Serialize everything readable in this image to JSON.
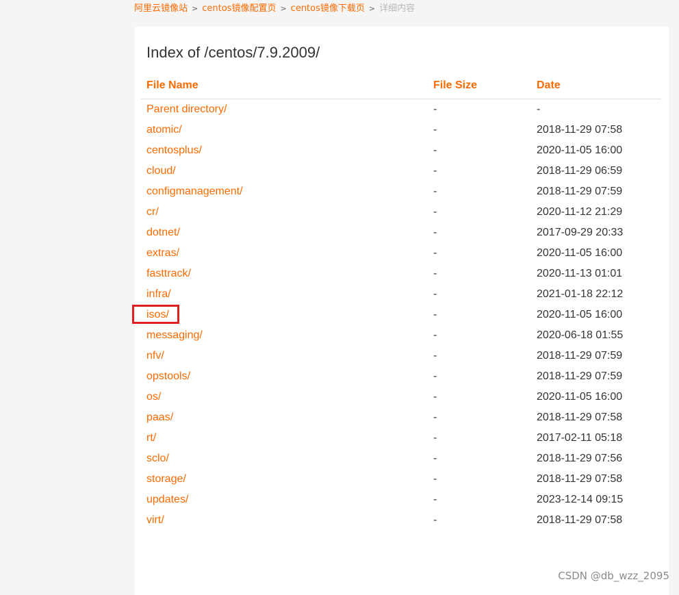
{
  "breadcrumb": {
    "items": [
      "阿里云镜像站",
      "centos镜像配置页",
      "centos镜像下载页"
    ],
    "current": "详细内容",
    "separator": ">"
  },
  "page": {
    "title": "Index of /centos/7.9.2009/"
  },
  "table": {
    "headers": {
      "name": "File Name",
      "size": "File Size",
      "date": "Date"
    },
    "rows": [
      {
        "name": "Parent directory/",
        "size": "-",
        "date": "-"
      },
      {
        "name": "atomic/",
        "size": "-",
        "date": "2018-11-29 07:58"
      },
      {
        "name": "centosplus/",
        "size": "-",
        "date": "2020-11-05 16:00"
      },
      {
        "name": "cloud/",
        "size": "-",
        "date": "2018-11-29 06:59"
      },
      {
        "name": "configmanagement/",
        "size": "-",
        "date": "2018-11-29 07:59"
      },
      {
        "name": "cr/",
        "size": "-",
        "date": "2020-11-12 21:29"
      },
      {
        "name": "dotnet/",
        "size": "-",
        "date": "2017-09-29 20:33"
      },
      {
        "name": "extras/",
        "size": "-",
        "date": "2020-11-05 16:00"
      },
      {
        "name": "fasttrack/",
        "size": "-",
        "date": "2020-11-13 01:01"
      },
      {
        "name": "infra/",
        "size": "-",
        "date": "2021-01-18 22:12"
      },
      {
        "name": "isos/",
        "size": "-",
        "date": "2020-11-05 16:00"
      },
      {
        "name": "messaging/",
        "size": "-",
        "date": "2020-06-18 01:55"
      },
      {
        "name": "nfv/",
        "size": "-",
        "date": "2018-11-29 07:59"
      },
      {
        "name": "opstools/",
        "size": "-",
        "date": "2018-11-29 07:59"
      },
      {
        "name": "os/",
        "size": "-",
        "date": "2020-11-05 16:00"
      },
      {
        "name": "paas/",
        "size": "-",
        "date": "2018-11-29 07:58"
      },
      {
        "name": "rt/",
        "size": "-",
        "date": "2017-02-11 05:18"
      },
      {
        "name": "sclo/",
        "size": "-",
        "date": "2018-11-29 07:56"
      },
      {
        "name": "storage/",
        "size": "-",
        "date": "2018-11-29 07:58"
      },
      {
        "name": "updates/",
        "size": "-",
        "date": "2023-12-14 09:15"
      },
      {
        "name": "virt/",
        "size": "-",
        "date": "2018-11-29 07:58"
      }
    ]
  },
  "watermark": "CSDN @db_wzz_2095",
  "colors": {
    "accent": "#ff6a00",
    "highlight_box": "#e02020",
    "text": "#333333",
    "muted": "#b8b8b8"
  }
}
